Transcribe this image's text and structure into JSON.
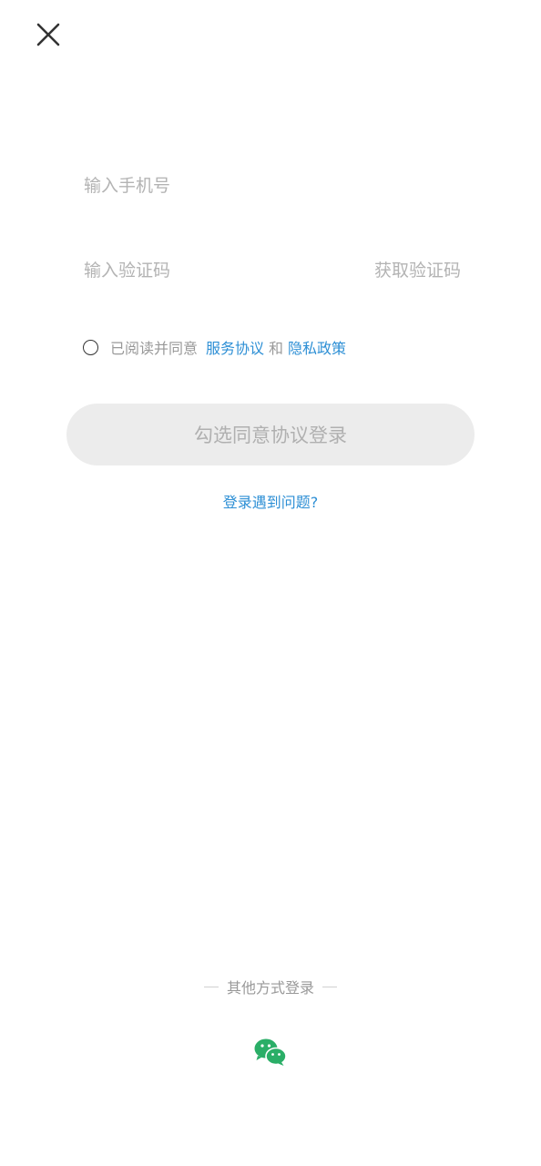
{
  "header": {
    "close_icon": "close-icon"
  },
  "form": {
    "phone_placeholder": "输入手机号",
    "phone_value": "",
    "code_placeholder": "输入验证码",
    "code_value": "",
    "get_code_label": "获取验证码"
  },
  "agreement": {
    "checked": false,
    "prefix": "已阅读并同意",
    "service_link": "服务协议",
    "and": "和",
    "privacy_link": "隐私政策"
  },
  "login_button": {
    "label": "勾选同意协议登录"
  },
  "problem_link": "登录遇到问题?",
  "other_login": {
    "label": "其他方式登录",
    "wechat_icon": "wechat-icon"
  },
  "colors": {
    "link": "#2d8fd5",
    "placeholder": "#b3b3b3",
    "button_bg": "#ececec",
    "button_text": "#b0b0b0",
    "wechat": "#2aae67"
  }
}
